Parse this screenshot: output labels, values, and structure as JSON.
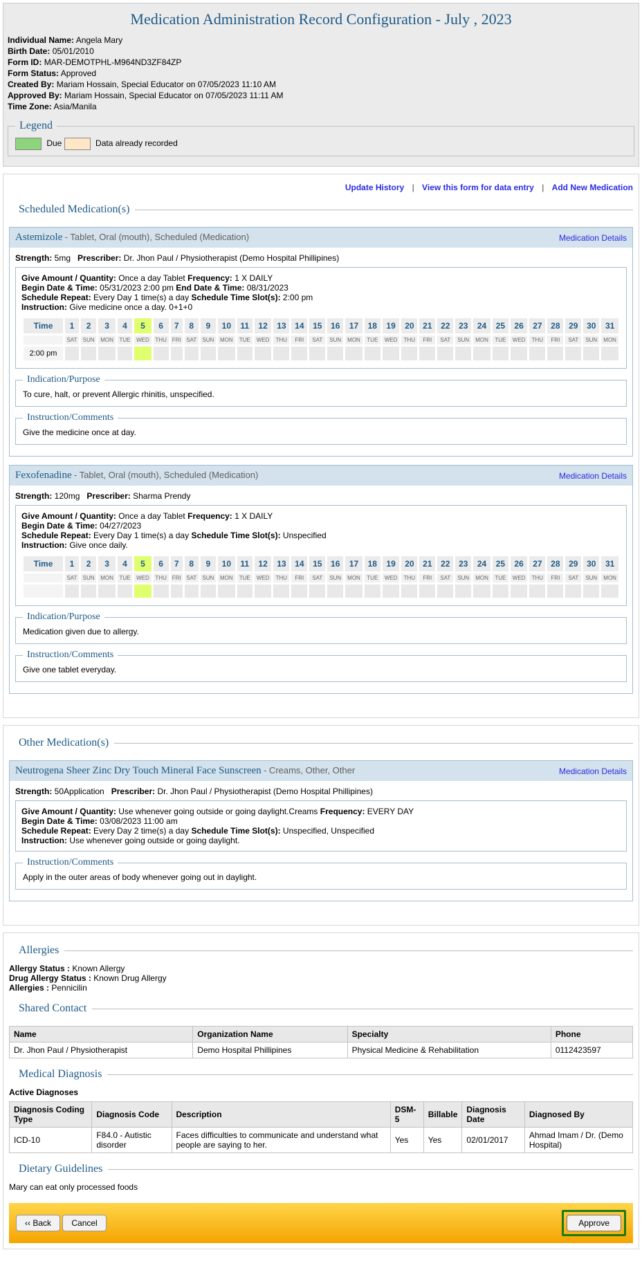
{
  "title": "Medication Administration Record Configuration - July , 2023",
  "meta": {
    "individual_label": "Individual Name:",
    "individual_value": "Angela Mary",
    "birth_label": "Birth Date:",
    "birth_value": "05/01/2010",
    "formid_label": "Form ID:",
    "formid_value": "MAR-DEMOTPHL-M964ND3ZF84ZP",
    "status_label": "Form Status:",
    "status_value": "Approved",
    "created_label": "Created By:",
    "created_value": "Mariam Hossain, Special Educator on 07/05/2023 11:10 AM",
    "approved_label": "Approved By:",
    "approved_value": "Mariam Hossain, Special Educator on 07/05/2023 11:11 AM",
    "tz_label": "Time Zone:",
    "tz_value": "Asia/Manila"
  },
  "legend": {
    "title": "Legend",
    "due": "Due",
    "recorded": "Data already recorded"
  },
  "top_links": {
    "update": "Update History",
    "view": "View this form for data entry",
    "add": "Add New Medication"
  },
  "sections": {
    "scheduled": "Scheduled Medication(s)",
    "other": "Other Medication(s)",
    "allergies": "Allergies",
    "shared": "Shared Contact",
    "diagnosis": "Medical Diagnosis",
    "dietary": "Dietary Guidelines"
  },
  "cal": {
    "time_h": "Time",
    "days": [
      "1",
      "2",
      "3",
      "4",
      "5",
      "6",
      "7",
      "8",
      "9",
      "10",
      "11",
      "12",
      "13",
      "14",
      "15",
      "16",
      "17",
      "18",
      "19",
      "20",
      "21",
      "22",
      "23",
      "24",
      "25",
      "26",
      "27",
      "28",
      "29",
      "30",
      "31"
    ],
    "dows": [
      "SAT",
      "SUN",
      "MON",
      "TUE",
      "WED",
      "THU",
      "FRI",
      "SAT",
      "SUN",
      "MON",
      "TUE",
      "WED",
      "THU",
      "FRI",
      "SAT",
      "SUN",
      "MON",
      "TUE",
      "WED",
      "THU",
      "FRI",
      "SAT",
      "SUN",
      "MON",
      "TUE",
      "WED",
      "THU",
      "FRI",
      "SAT",
      "SUN",
      "MON"
    ],
    "today_index": 4
  },
  "labels": {
    "strength": "Strength:",
    "prescriber": "Prescriber:",
    "give": "Give Amount / Quantity:",
    "frequency": "Frequency:",
    "begin": "Begin Date & Time:",
    "end": "End Date & Time:",
    "repeat": "Schedule Repeat:",
    "slots": "Schedule Time Slot(s):",
    "instruction": "Instruction:",
    "details_link": "Medication Details",
    "indication": "Indication/Purpose",
    "comments": "Instruction/Comments"
  },
  "med1": {
    "name": "Astemizole",
    "sub": " - Tablet, Oral (mouth), Scheduled (Medication)",
    "strength": "5mg",
    "prescriber": "Dr. Jhon Paul / Physiotherapist (Demo Hospital Phillipines)",
    "give": "Once a day Tablet",
    "frequency": "1 X DAILY",
    "begin": "05/31/2023 2:00 pm",
    "end": "08/31/2023",
    "repeat": "Every Day 1 time(s) a day",
    "slots": "2:00 pm",
    "instruction": "Give medicine once a day. 0+1+0",
    "time_row": "2:00 pm",
    "indication": "To cure, halt, or prevent Allergic rhinitis, unspecified.",
    "comments": "Give the medicine once at day."
  },
  "med2": {
    "name": "Fexofenadine",
    "sub": " - Tablet, Oral (mouth), Scheduled (Medication)",
    "strength": "120mg",
    "prescriber": "Sharma Prendy",
    "give": "Once a day Tablet",
    "frequency": "1 X DAILY",
    "begin": "04/27/2023",
    "repeat": "Every Day 1 time(s) a day",
    "slots": "Unspecified",
    "instruction": "Give once daily.",
    "time_row": "",
    "indication": "Medication given due to allergy.",
    "comments": "Give one tablet everyday."
  },
  "med3": {
    "name": "Neutrogena Sheer Zinc Dry Touch Mineral Face Sunscreen",
    "sub": " - Creams, Other, Other",
    "strength": "50Application",
    "prescriber": "Dr. Jhon Paul / Physiotherapist (Demo Hospital Phillipines)",
    "give": "Use whenever going outside or going daylight.Creams",
    "frequency": "EVERY DAY",
    "begin": "03/08/2023 11:00 am",
    "repeat": "Every Day 2 time(s) a day",
    "slots": "Unspecified, Unspecified",
    "instruction": "Use whenever going outside or going daylight.",
    "comments": "Apply in the outer areas of body whenever going out in daylight."
  },
  "allergies": {
    "status_l": "Allergy Status :",
    "status_v": "Known Allergy",
    "drug_l": "Drug Allergy Status :",
    "drug_v": "Known Drug Allergy",
    "all_l": "Allergies :",
    "all_v": "Pennicilin"
  },
  "shared": {
    "headers": {
      "name": "Name",
      "org": "Organization Name",
      "spec": "Specialty",
      "phone": "Phone"
    },
    "row": {
      "name": "Dr. Jhon Paul / Physiotherapist",
      "org": "Demo Hospital Phillipines",
      "spec": "Physical Medicine & Rehabilitation",
      "phone": "0112423597"
    }
  },
  "diagnosis": {
    "active": "Active Diagnoses",
    "headers": {
      "type": "Diagnosis Coding Type",
      "code": "Diagnosis Code",
      "desc": "Description",
      "dsm": "DSM-5",
      "bill": "Billable",
      "date": "Diagnosis Date",
      "by": "Diagnosed By"
    },
    "row": {
      "type": "ICD-10",
      "code": "F84.0 - Autistic disorder",
      "desc": "Faces difficulties to communicate and understand what people are saying to her.",
      "dsm": "Yes",
      "bill": "Yes",
      "date": "02/01/2017",
      "by": "Ahmad Imam / Dr. (Demo Hospital)"
    }
  },
  "dietary": {
    "text": "Mary can eat only processed foods"
  },
  "buttons": {
    "back": "‹‹ Back",
    "cancel": "Cancel",
    "approve": "Approve"
  }
}
